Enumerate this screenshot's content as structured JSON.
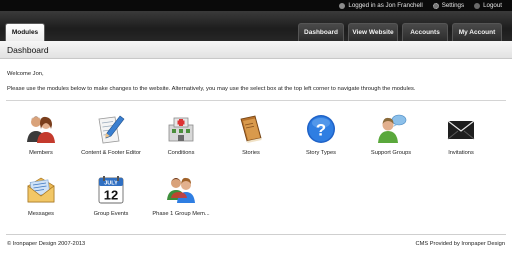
{
  "topbar": {
    "logged_in": "Logged in as Jon Franchell",
    "settings": "Settings",
    "logout": "Logout"
  },
  "header": {
    "modules_tab": "Modules",
    "nav": [
      "Dashboard",
      "View Website",
      "Accounts",
      "My Account"
    ]
  },
  "page": {
    "title": "Dashboard",
    "welcome": "Welcome Jon,",
    "instructions": "Please use the modules below to make changes to the website. Alternatively, you may use the select box at the top left corner to navigate through the modules."
  },
  "modules": [
    {
      "label": "Members",
      "icon": "members-icon"
    },
    {
      "label": "Content & Footer Editor",
      "icon": "content-editor-icon"
    },
    {
      "label": "Conditions",
      "icon": "conditions-icon"
    },
    {
      "label": "Stories",
      "icon": "stories-icon"
    },
    {
      "label": "Story Types",
      "icon": "help-icon"
    },
    {
      "label": "Support Groups",
      "icon": "support-groups-icon"
    },
    {
      "label": "Invitations",
      "icon": "invitations-icon"
    },
    {
      "label": "Messages",
      "icon": "messages-icon"
    },
    {
      "label": "Group Events",
      "icon": "calendar-icon"
    },
    {
      "label": "Phase 1 Group Mem...",
      "icon": "group-members-icon"
    }
  ],
  "calendar": {
    "month": "JULY",
    "day": "12"
  },
  "footer": {
    "copyright": "© Ironpaper Design 2007-2013",
    "credit": "CMS Provided by Ironpaper Design"
  }
}
